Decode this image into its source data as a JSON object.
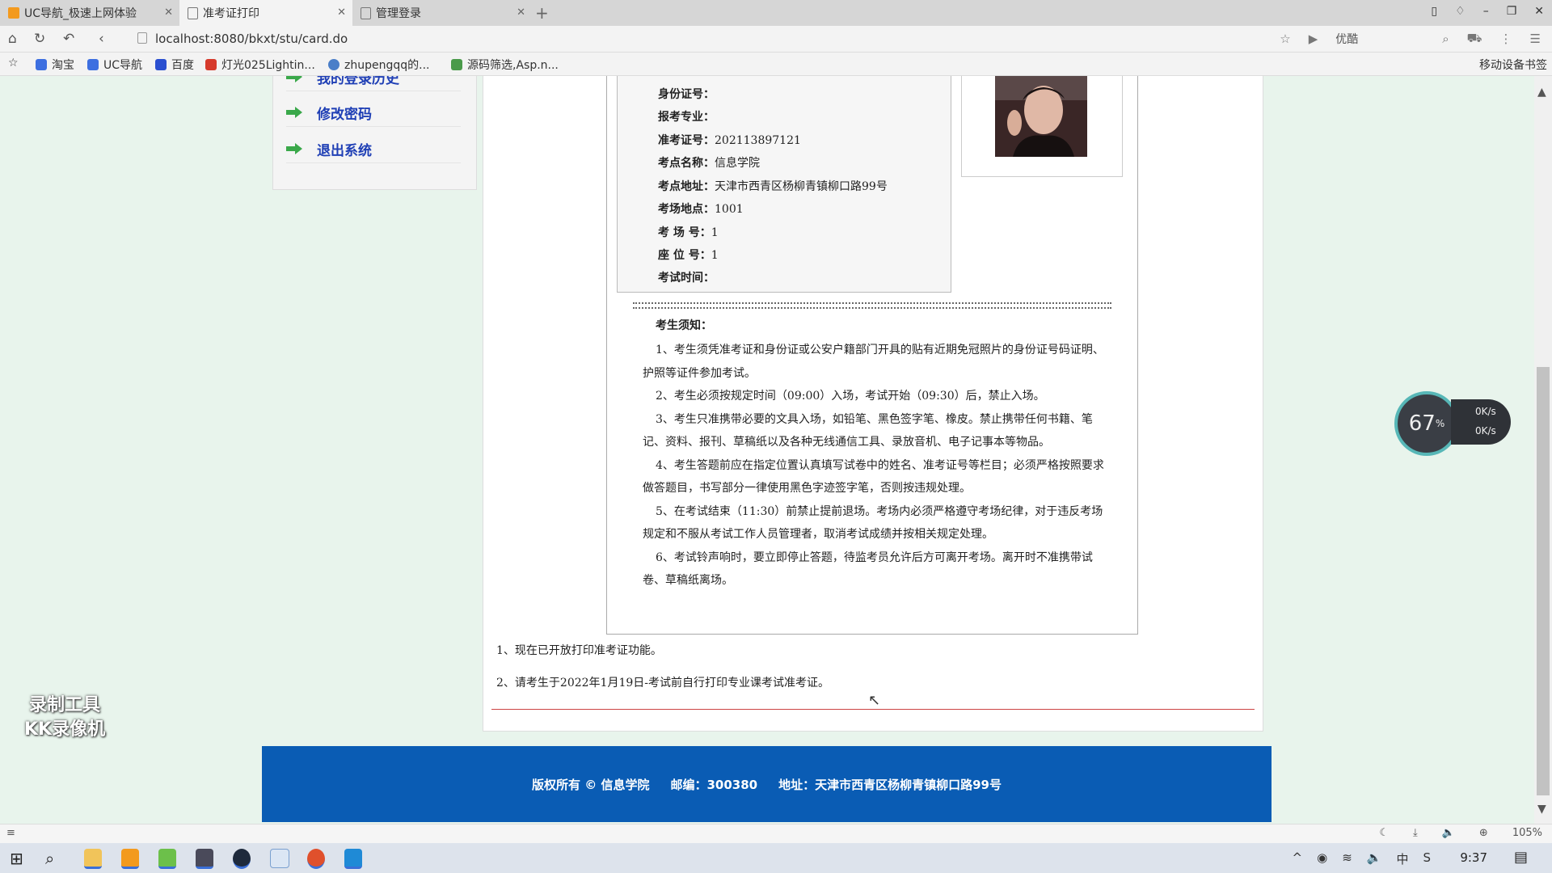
{
  "browser": {
    "tabs": [
      {
        "title": "UC导航_极速上网体验",
        "icon": "uc-logo-icon",
        "active": false
      },
      {
        "title": "准考证打印",
        "icon": "page-icon",
        "active": true
      },
      {
        "title": "管理登录",
        "icon": "page-icon",
        "active": false
      }
    ],
    "new_tab": "+",
    "url": "localhost:8080/bkxt/stu/card.do",
    "search_engine": "优酷",
    "bookmarks": [
      "淘宝",
      "UC导航",
      "百度",
      "灯光025Lightin...",
      "zhupengqq的...",
      "源码筛选,Asp.n..."
    ],
    "mobile_bookmarks": "移动设备书签",
    "zoom": "105%"
  },
  "sidebar": {
    "items": [
      {
        "label": "我的登录历史"
      },
      {
        "label": "修改密码"
      },
      {
        "label": "退出系统"
      }
    ]
  },
  "card": {
    "fields": [
      {
        "label": "身份证号：",
        "value": ""
      },
      {
        "label": "报考专业：",
        "value": ""
      },
      {
        "label": "准考证号：",
        "value": "202113897121"
      },
      {
        "label": "考点名称：",
        "value": "信息学院"
      },
      {
        "label": "考点地址：",
        "value": "天津市西青区杨柳青镇柳口路99号"
      },
      {
        "label": "考场地点：",
        "value": "1001"
      },
      {
        "label": "考 场 号：",
        "value": "1"
      },
      {
        "label": "座 位 号：",
        "value": "1"
      },
      {
        "label": "考试时间：",
        "value": ""
      }
    ],
    "notice_title": "考生须知：",
    "notice": [
      "1、考生须凭准考证和身份证或公安户籍部门开具的贴有近期免冠照片的身份证号码证明、护照等证件参加考试。",
      "2、考生必须按规定时间（09:00）入场，考试开始（09:30）后，禁止入场。",
      "3、考生只准携带必要的文具入场，如铅笔、黑色签字笔、橡皮。禁止携带任何书籍、笔记、资料、报刊、草稿纸以及各种无线通信工具、录放音机、电子记事本等物品。",
      "4、考生答题前应在指定位置认真填写试卷中的姓名、准考证号等栏目；必须严格按照要求做答题目，书写部分一律使用黑色字迹签字笔，否则按违规处理。",
      "5、在考试结束（11:30）前禁止提前退场。考场内必须严格遵守考场纪律，对于违反考场规定和不服从考试工作人员管理者，取消考试成绩并按相关规定处理。",
      "6、考试铃声响时，要立即停止答题，待监考员允许后方可离开考场。离开时不准携带试卷、草稿纸离场。"
    ]
  },
  "tips": [
    "1、现在已开放打印准考证功能。",
    "2、请考生于2022年1月19日-考试前自行打印专业课考试准考证。"
  ],
  "footer": {
    "copyright": "版权所有 © 信息学院",
    "postcode": "邮编：300380",
    "address": "地址：天津市西青区杨柳青镇柳口路99号"
  },
  "speed_widget": {
    "percent": "67",
    "unit": "%",
    "up": "0K/s",
    "down": "0K/s"
  },
  "watermark": [
    "录制工具",
    "KK录像机"
  ],
  "taskbar": {
    "time": "9:37"
  },
  "colors": {
    "footer_bg": "#0a5cb4",
    "sidebar_link": "#1f3fb5",
    "arrow": "#3aa84a",
    "page_bg": "#e8f4ec"
  }
}
